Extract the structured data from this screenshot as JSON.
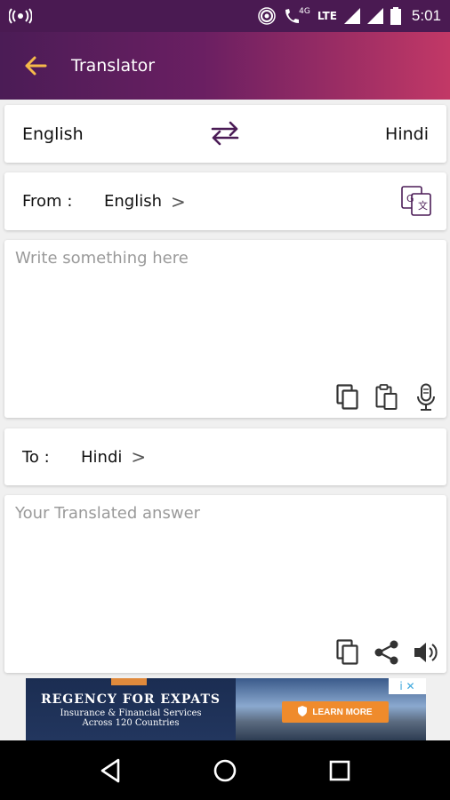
{
  "status_bar": {
    "time": "5:01",
    "network_label": "4G",
    "lte_label": "LTE"
  },
  "app_bar": {
    "title": "Translator",
    "back_icon": "arrow-left-icon",
    "accent_color": "#f5b94a"
  },
  "language_bar": {
    "source": "English",
    "target": "Hindi",
    "swap_icon": "swap-arrows-icon"
  },
  "from": {
    "label": "From :",
    "value": "English",
    "chevron": ">"
  },
  "input": {
    "placeholder": "Write something here",
    "value": "",
    "tools": [
      "copy-icon",
      "paste-icon",
      "mic-icon"
    ]
  },
  "to": {
    "label": "To :",
    "value": "Hindi",
    "chevron": ">"
  },
  "output": {
    "placeholder": "Your Translated answer",
    "tools": [
      "copy-icon",
      "share-icon",
      "speaker-icon"
    ]
  },
  "ad": {
    "headline": "REGENCY FOR EXPATS",
    "line1": "Insurance & Financial Services",
    "line2": "Across 120 Countries",
    "cta": "LEARN MORE",
    "adchoices": "i  ✕"
  },
  "colors": {
    "primary_dark": "#4b1c56",
    "primary_end": "#c23866"
  }
}
